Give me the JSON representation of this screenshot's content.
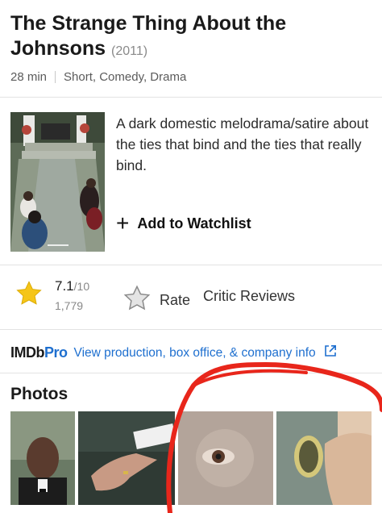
{
  "title": {
    "main": "The Strange Thing About the Johnsons",
    "year": "(2011)"
  },
  "meta": {
    "runtime": "28 min",
    "genres": "Short, Comedy, Drama"
  },
  "plot": "A dark domestic melodrama/satire about the ties that bind and the ties that really bind.",
  "watchlist": {
    "label": "Add to Watchlist"
  },
  "rating": {
    "value": "7.1",
    "max": "/10",
    "count": "1,779",
    "rate_label": "Rate",
    "critic_label": "Critic Reviews"
  },
  "pro": {
    "logo_left": "IMDb",
    "logo_right": "Pro",
    "link": "View production, box office, & company info"
  },
  "photos": {
    "heading": "Photos"
  },
  "colors": {
    "star": "#f5c518",
    "link": "#1e6fcf",
    "annotation": "#e8261b"
  },
  "icons": [
    "plus-icon",
    "star-icon",
    "star-outline-icon",
    "external-link-icon"
  ]
}
